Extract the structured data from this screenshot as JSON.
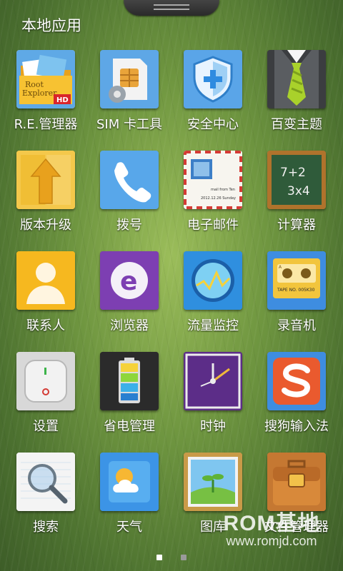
{
  "folder": {
    "title": "本地应用"
  },
  "apps": [
    {
      "label": "R.E.管理器",
      "icon": "root-explorer-icon"
    },
    {
      "label": "SIM 卡工具",
      "icon": "sim-card-icon"
    },
    {
      "label": "安全中心",
      "icon": "shield-icon"
    },
    {
      "label": "百变主题",
      "icon": "tie-suit-icon"
    },
    {
      "label": "版本升级",
      "icon": "upgrade-arrow-icon"
    },
    {
      "label": "拨号",
      "icon": "phone-icon"
    },
    {
      "label": "电子邮件",
      "icon": "mail-envelope-icon"
    },
    {
      "label": "计算器",
      "icon": "chalkboard-calculator-icon"
    },
    {
      "label": "联系人",
      "icon": "contact-person-icon"
    },
    {
      "label": "浏览器",
      "icon": "browser-e-icon"
    },
    {
      "label": "流量监控",
      "icon": "traffic-monitor-icon"
    },
    {
      "label": "录音机",
      "icon": "cassette-icon"
    },
    {
      "label": "设置",
      "icon": "settings-switch-icon"
    },
    {
      "label": "省电管理",
      "icon": "battery-icon"
    },
    {
      "label": "时钟",
      "icon": "clock-icon"
    },
    {
      "label": "搜狗输入法",
      "icon": "sogou-s-icon"
    },
    {
      "label": "搜索",
      "icon": "magnifier-icon"
    },
    {
      "label": "天气",
      "icon": "weather-sun-cloud-icon"
    },
    {
      "label": "图库",
      "icon": "gallery-icon"
    },
    {
      "label": "文件管理器",
      "icon": "briefcase-icon"
    }
  ],
  "icon_text": {
    "re_line1": "Root",
    "re_line2": "Explorer",
    "re_badge": "HD",
    "calc_line1": "7+2",
    "calc_line2": "3x4",
    "browser_letter": "e",
    "tape_label": "TAPE NO. 005K30",
    "tape_side": "A",
    "mail_from": "mail from Ten",
    "mail_date": "2012.12.26 Sunday"
  },
  "page_indicator": {
    "count": 2,
    "active": 0
  },
  "watermark": {
    "brand": "ROM基地",
    "url": "www.romjd.com"
  }
}
